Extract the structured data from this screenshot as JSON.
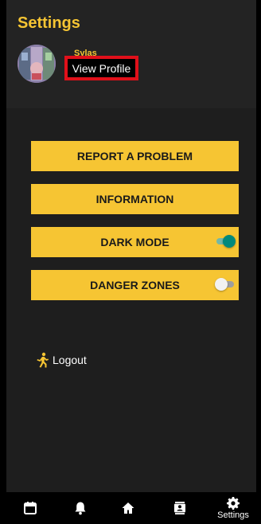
{
  "header": {
    "title": "Settings",
    "username": "Sylas",
    "view_profile_label": "View Profile"
  },
  "menu": {
    "report_problem": "REPORT A PROBLEM",
    "information": "INFORMATION",
    "dark_mode": "DARK MODE",
    "danger_zones": "DANGER ZONES"
  },
  "toggles": {
    "dark_mode_on": true,
    "danger_zones_on": false
  },
  "logout_label": "Logout",
  "navbar": {
    "items": [
      {
        "icon": "calendar-icon",
        "label": ""
      },
      {
        "icon": "bell-icon",
        "label": ""
      },
      {
        "icon": "home-icon",
        "label": ""
      },
      {
        "icon": "contacts-icon",
        "label": ""
      },
      {
        "icon": "gear-icon",
        "label": "Settings"
      }
    ]
  },
  "colors": {
    "accent": "#f6c533",
    "background": "#1e1e1e",
    "toggle_on": "#00897b"
  }
}
